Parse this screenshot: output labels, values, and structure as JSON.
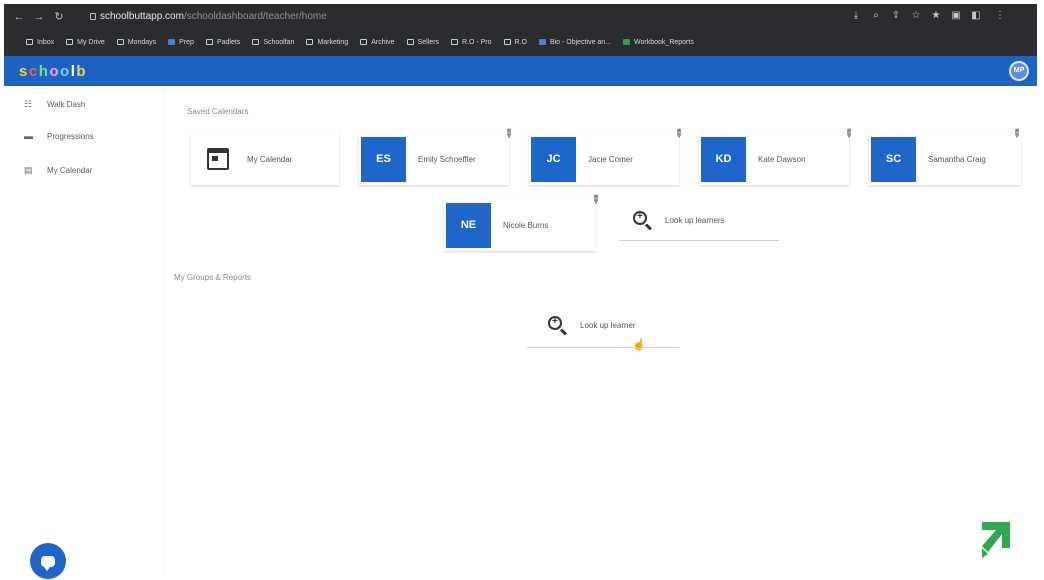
{
  "browser": {
    "url_host": "schoolbuttapp.com",
    "url_path": "/schooldashboard/teacher/home",
    "bookmarks": [
      {
        "label": "Inbox",
        "icon": "mail-icon"
      },
      {
        "label": "My Drive",
        "icon": "drive-icon"
      },
      {
        "label": "Mondays",
        "icon": "folder-icon"
      },
      {
        "label": "Prep",
        "icon": "doc-icon",
        "color": "blue"
      },
      {
        "label": "Padlets",
        "icon": "folder-icon"
      },
      {
        "label": "Schoolfan",
        "icon": "folder-icon"
      },
      {
        "label": "Marketing",
        "icon": "folder-icon"
      },
      {
        "label": "Archive",
        "icon": "folder-icon"
      },
      {
        "label": "Sellers",
        "icon": "folder-icon"
      },
      {
        "label": "R.O - Pro",
        "icon": "link-icon"
      },
      {
        "label": "R.O",
        "icon": "folder-icon"
      },
      {
        "label": "Bio - Objective an...",
        "icon": "doc-icon",
        "color": "blue"
      },
      {
        "label": "Workbook_Reports",
        "icon": "sheet-icon",
        "color": "green"
      }
    ]
  },
  "header": {
    "logo_letters": [
      "s",
      "c",
      "h",
      "o",
      "o",
      "l",
      "b"
    ],
    "logo_colors": [
      "#ffcc33",
      "#ff5a5a",
      "#7ee07e",
      "#ff9de0",
      "#6fd7ff",
      "#ffffff",
      "#ffd04a"
    ],
    "avatar_initials": "MP"
  },
  "sidebar": {
    "items": [
      {
        "label": "Walk Dash",
        "icon": "grid-icon"
      },
      {
        "label": "Progressions",
        "icon": "list-icon"
      },
      {
        "label": "My Calendar",
        "icon": "calendar-icon"
      }
    ]
  },
  "main": {
    "section1_title": "Saved Calendars",
    "section2_title": "My Groups & Reports",
    "my_calendar_label": "My Calendar",
    "calendars": [
      {
        "initials": "ES",
        "name": "Emily Schoeffler"
      },
      {
        "initials": "JC",
        "name": "Jacie Comer"
      },
      {
        "initials": "KD",
        "name": "Kate Dawson"
      },
      {
        "initials": "SC",
        "name": "Samantha Craig"
      },
      {
        "initials": "NE",
        "name": "Nicole Burns"
      }
    ],
    "lookup_label_1": "Look up learners",
    "lookup_label_2": "Look up learner"
  },
  "colors": {
    "accent": "#1e66c9",
    "header": "#1d63c3",
    "chrome": "#2b2c30",
    "brand_green": "#2fa84f"
  }
}
